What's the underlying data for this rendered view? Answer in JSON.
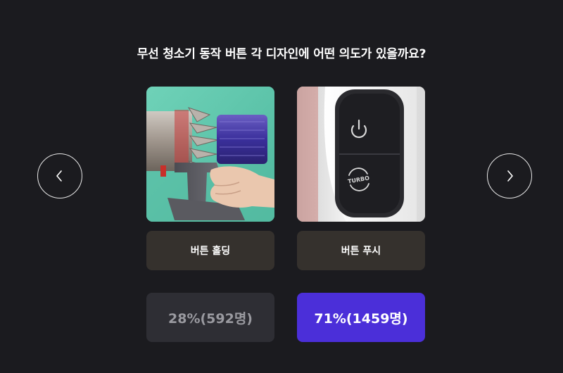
{
  "question": "무선 청소기 동작 버튼 각 디자인에 어떤 의도가 있을까요?",
  "navigation": {
    "prev_icon": "chevron-left-icon",
    "next_icon": "chevron-right-icon"
  },
  "options": [
    {
      "label": "버튼 홀딩",
      "image": "vacuum-trigger-hold-photo",
      "result": "28%(592명)"
    },
    {
      "label": "버튼 푸시",
      "image": "vacuum-power-turbo-buttons-photo",
      "result": "71%(1459명)"
    }
  ],
  "colors": {
    "background": "#1b1b1f",
    "label_bg": "#35312d",
    "result_bg": "#2e2e34",
    "result_selected_bg": "#4b2fd9"
  }
}
